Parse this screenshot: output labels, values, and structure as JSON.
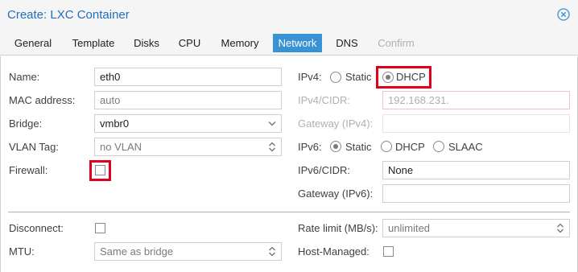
{
  "window": {
    "title": "Create: LXC Container"
  },
  "tabs": [
    {
      "label": "General",
      "state": "normal"
    },
    {
      "label": "Template",
      "state": "normal"
    },
    {
      "label": "Disks",
      "state": "normal"
    },
    {
      "label": "CPU",
      "state": "normal"
    },
    {
      "label": "Memory",
      "state": "normal"
    },
    {
      "label": "Network",
      "state": "active"
    },
    {
      "label": "DNS",
      "state": "normal"
    },
    {
      "label": "Confirm",
      "state": "disabled"
    }
  ],
  "left": {
    "name": {
      "label": "Name:",
      "value": "eth0"
    },
    "mac": {
      "label": "MAC address:",
      "value": "auto"
    },
    "bridge": {
      "label": "Bridge:",
      "value": "vmbr0"
    },
    "vlan": {
      "label": "VLAN Tag:",
      "value": "no VLAN"
    },
    "firewall": {
      "label": "Firewall:",
      "checked": false
    }
  },
  "right": {
    "ipv4": {
      "label": "IPv4:",
      "options": [
        "Static",
        "DHCP"
      ],
      "selected": "DHCP"
    },
    "ipv4_cidr": {
      "label": "IPv4/CIDR:",
      "placeholder": "192.168.231."
    },
    "gateway4": {
      "label": "Gateway (IPv4):",
      "value": ""
    },
    "ipv6": {
      "label": "IPv6:",
      "options": [
        "Static",
        "DHCP",
        "SLAAC"
      ],
      "selected": "Static"
    },
    "ipv6_cidr": {
      "label": "IPv6/CIDR:",
      "value": "None"
    },
    "gateway6": {
      "label": "Gateway (IPv6):",
      "value": ""
    }
  },
  "advanced": {
    "disconnect": {
      "label": "Disconnect:",
      "checked": false
    },
    "mtu": {
      "label": "MTU:",
      "value": "Same as bridge"
    },
    "rate_limit": {
      "label": "Rate limit (MB/s):",
      "value": "unlimited"
    },
    "host_managed": {
      "label": "Host-Managed:",
      "checked": false
    }
  },
  "colors": {
    "accent": "#3892d3",
    "title": "#1f6fbf",
    "highlight": "#e0001b"
  }
}
